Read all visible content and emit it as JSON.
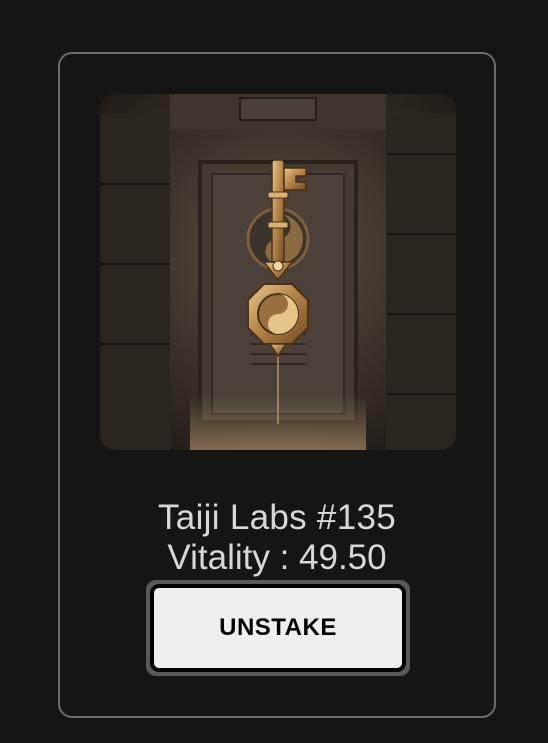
{
  "card": {
    "image_alt": "golden yin-yang key in front of stone temple door",
    "title": "Taiji Labs #135",
    "vitality": "Vitality : 49.50",
    "unstake_label": "UNSTAKE"
  },
  "colors": {
    "background": "#151515",
    "card_border": "#6c6c6c",
    "text": "#d8d8d8",
    "button_bg": "#efefef",
    "button_border": "#000000"
  }
}
